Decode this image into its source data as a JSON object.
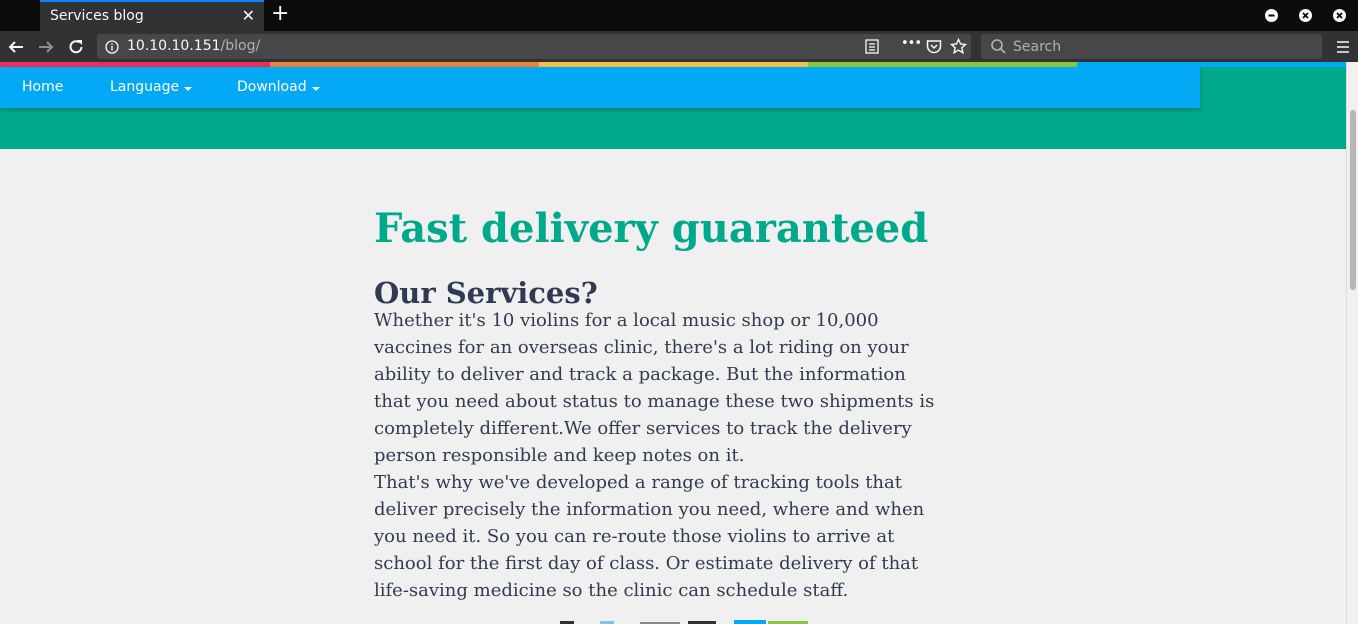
{
  "browser": {
    "tab_title": "Services blog",
    "url_host": "10.10.10.151",
    "url_path": "/blog/",
    "search_placeholder": "Search",
    "menu_dots": "•••"
  },
  "site_nav": {
    "items": [
      {
        "label": "Home",
        "dropdown": false
      },
      {
        "label": "Language",
        "dropdown": true
      },
      {
        "label": "Download",
        "dropdown": true
      }
    ]
  },
  "article": {
    "headline": "Fast delivery guaranteed",
    "subheading": "Our Services?",
    "body_lines": [
      "Whether it's 10 violins for a local music shop or 10,000",
      "vaccines for an overseas clinic, there's a lot riding on your",
      "ability to deliver and track a package. But the information",
      "that you need about status to manage these two shipments is",
      "completely different.We offer services to track the delivery",
      "person responsible and keep notes on it.",
      "That's why we've developed a range of tracking tools that",
      "deliver precisely the information you need, where and when",
      "you need it. So you can re-route those violins to arrive at",
      "school for the first day of class. Or estimate delivery of that",
      "life-saving medicine so the clinic can schedule staff."
    ]
  },
  "colors": {
    "hero_green": "#00a98c",
    "nav_blue": "#03a9f4",
    "stripe": [
      "#e8305a",
      "#f0813a",
      "#f5c244",
      "#8cc63f",
      "#03a9f4"
    ],
    "text": "#2e3b52"
  },
  "icons": [
    "back-icon",
    "forward-icon",
    "reload-icon",
    "info-icon",
    "reader-view-icon",
    "page-actions-icon",
    "pocket-icon",
    "bookmark-star-icon",
    "search-icon",
    "hamburger-menu-icon",
    "minimize-icon",
    "restore-icon",
    "close-window-icon",
    "tab-close-icon",
    "new-tab-icon"
  ]
}
